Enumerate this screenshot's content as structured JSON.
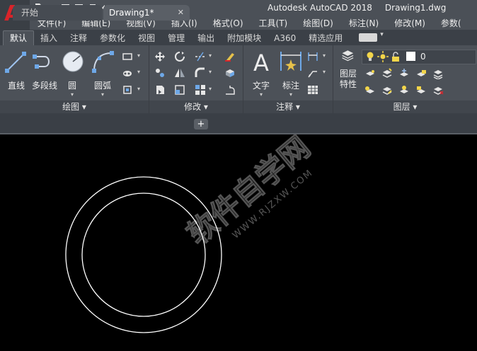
{
  "window": {
    "app_name": "Autodesk AutoCAD 2018",
    "file_name": "Drawing1.dwg"
  },
  "menu": [
    "文件(F)",
    "编辑(E)",
    "视图(V)",
    "插入(I)",
    "格式(O)",
    "工具(T)",
    "绘图(D)",
    "标注(N)",
    "修改(M)",
    "参数("
  ],
  "ribbon_tabs": [
    "默认",
    "插入",
    "注释",
    "参数化",
    "视图",
    "管理",
    "输出",
    "附加模块",
    "A360",
    "精选应用"
  ],
  "draw_panel": {
    "title": "绘图",
    "tools": [
      "直线",
      "多段线",
      "圆",
      "圆弧"
    ]
  },
  "modify_panel": {
    "title": "修改"
  },
  "annotation_panel": {
    "title": "注释",
    "tools": [
      "文字",
      "标注"
    ]
  },
  "layers_panel": {
    "title": "图层",
    "layer_props": [
      "图层",
      "特性"
    ],
    "current_layer": "0"
  },
  "doc_tabs": {
    "start": "开始",
    "active": "Drawing1*"
  },
  "watermark": {
    "text": "软件自学网",
    "url": "WWW.RJZXW.COM"
  },
  "colors": {
    "accent_logo": "#d8242a",
    "canvas": "#000000",
    "ribbon": "#4c5158"
  }
}
